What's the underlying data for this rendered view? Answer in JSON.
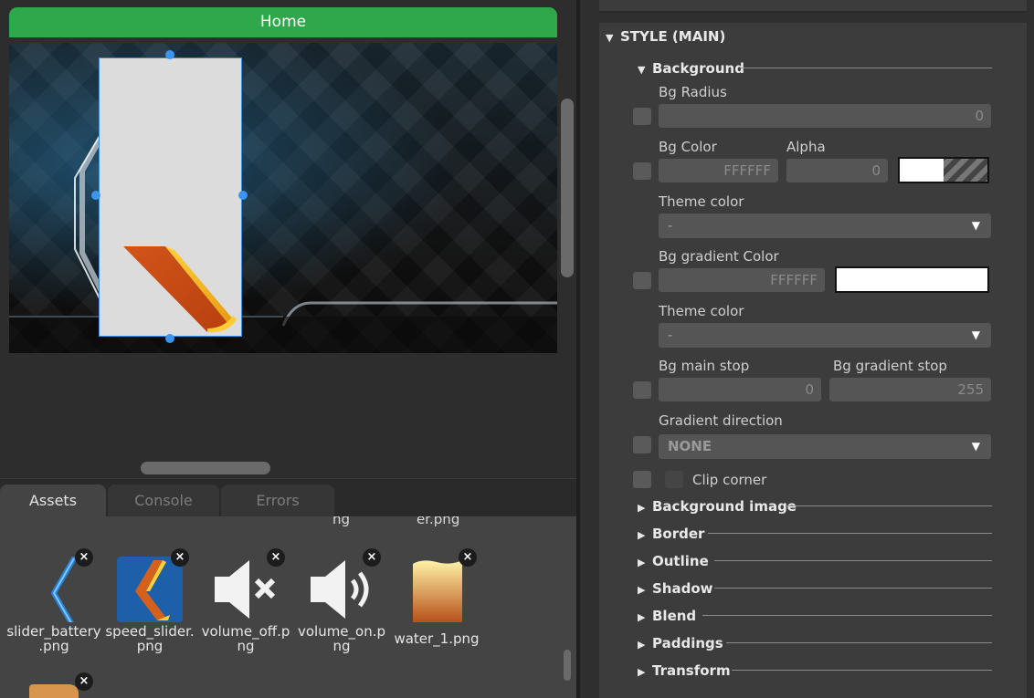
{
  "screen": {
    "title": "Home"
  },
  "bottom_tabs": [
    {
      "label": "Assets",
      "active": true
    },
    {
      "label": "Console",
      "active": false
    },
    {
      "label": "Errors",
      "active": false
    }
  ],
  "assets": {
    "cut_off_labels": [
      "ng",
      "er.png"
    ],
    "items": [
      {
        "name": "slider_battery.png",
        "name_line1": "slider_battery",
        "name_line2": ".png",
        "icon": "chevron-left-icon"
      },
      {
        "name": "speed_slider.png",
        "name_line1": "speed_slider.",
        "name_line2": "png",
        "icon": "speed-slider-icon"
      },
      {
        "name": "volume_off.png",
        "name_line1": "volume_off.p",
        "name_line2": "ng",
        "icon": "volume-off-icon"
      },
      {
        "name": "volume_on.png",
        "name_line1": "volume_on.p",
        "name_line2": "ng",
        "icon": "volume-on-icon"
      },
      {
        "name": "water_1.png",
        "name_line1": "water_1.png",
        "name_line2": "",
        "icon": "water-icon"
      }
    ],
    "remove_glyph": "×"
  },
  "style_panel": {
    "section_title": "STYLE (MAIN)",
    "background": {
      "title": "Background",
      "bg_radius_label": "Bg Radius",
      "bg_radius_value": "0",
      "bg_color_label": "Bg Color",
      "bg_color_value": "FFFFFF",
      "alpha_label": "Alpha",
      "alpha_value": "0",
      "theme_color_label": "Theme color",
      "theme_color_value": "-",
      "bg_gradient_color_label": "Bg gradient Color",
      "bg_gradient_color_value": "FFFFFF",
      "theme_color2_label": "Theme color",
      "theme_color2_value": "-",
      "bg_main_stop_label": "Bg main stop",
      "bg_main_stop_value": "0",
      "bg_gradient_stop_label": "Bg gradient stop",
      "bg_gradient_stop_value": "255",
      "gradient_direction_label": "Gradient direction",
      "gradient_direction_value": "NONE",
      "clip_corner_label": "Clip corner"
    },
    "collapsed_sections": [
      "Background image",
      "Border",
      "Outline",
      "Shadow",
      "Blend",
      "Paddings",
      "Transform"
    ]
  },
  "colors": {
    "header_green": "#2ea84a",
    "selection_blue": "#3a96f0"
  }
}
